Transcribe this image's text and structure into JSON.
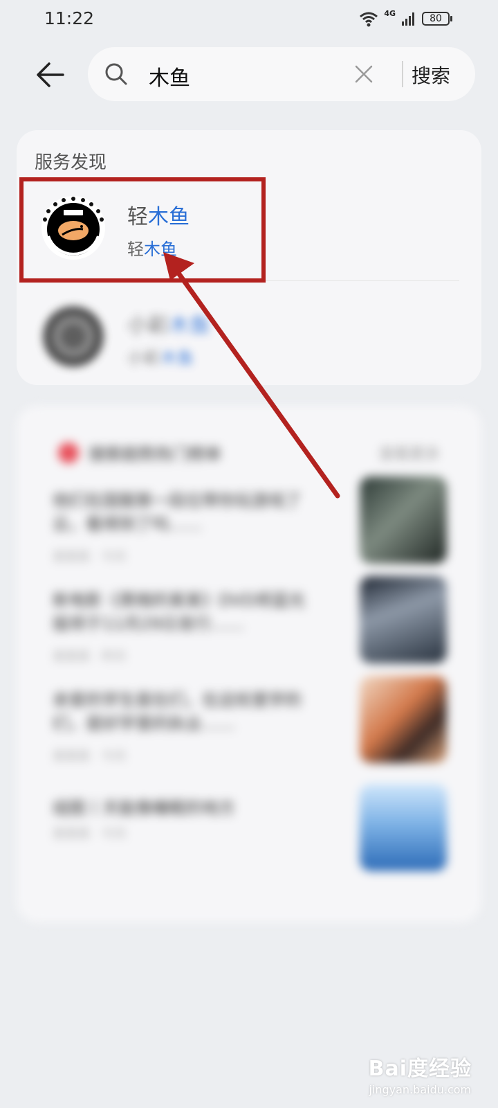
{
  "status_bar": {
    "time": "11:22",
    "network": "4G",
    "battery": "80"
  },
  "search": {
    "query": "木鱼",
    "button_label": "搜索"
  },
  "services": {
    "title": "服务发现",
    "results": [
      {
        "name_prefix": "轻",
        "name_match": "木鱼",
        "sub_prefix": "轻",
        "sub_match": "木鱼"
      },
      {
        "name_prefix": "小彩",
        "name_match": "木鱼",
        "sub_prefix": "小彩",
        "sub_match": "木鱼"
      }
    ]
  },
  "hot_list": {
    "title": "搜索趋势热门榜单",
    "more": "查看更多",
    "items": [
      {
        "title": "他们在国服第一段位带你玩游戏了云，看得到了吗……",
        "meta": "某某某 · 今天"
      },
      {
        "title": "新电影《黑暗的某某》DVD将蓝光版将于11月29日发行……",
        "meta": "某某某 · 昨天"
      },
      {
        "title": "亲爱的学生是在们，在这校里学的们，是好学里的执业……",
        "meta": "某某某 · 今天"
      },
      {
        "title": "组图丨天能像睡眠的地方",
        "meta": "某某某 · 今天"
      }
    ]
  },
  "colors": {
    "highlight": "#2a6fd6",
    "annotation": "#b3221f"
  },
  "watermark": {
    "logo": "Bai度经验",
    "url": "jingyan.baidu.com"
  }
}
